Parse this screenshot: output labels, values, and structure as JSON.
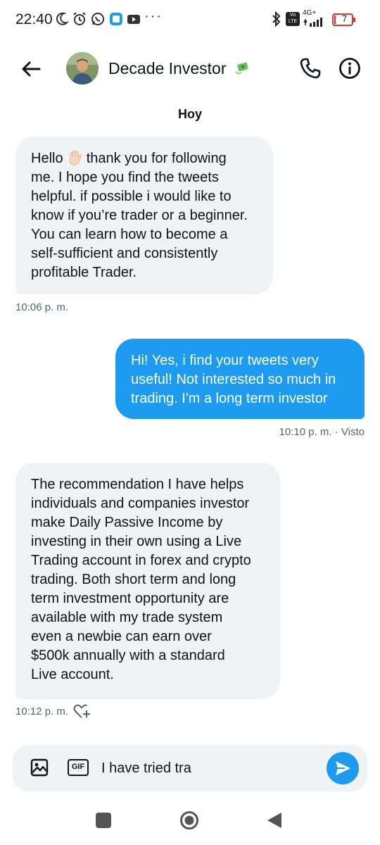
{
  "status_bar": {
    "time": "22:40",
    "network": "4G+",
    "volte": "Vo LTE",
    "battery": "7",
    "overflow": "···"
  },
  "header": {
    "contact_name": "Decade Investor",
    "icons": [
      "back-arrow-icon",
      "money-with-wings-emoji",
      "phone-icon",
      "info-icon"
    ]
  },
  "conversation": {
    "date_label": "Hoy",
    "messages": [
      {
        "direction": "incoming",
        "text_before_emoji": "Hello ",
        "emoji": "waving-hand-emoji",
        "text": " thank you for following\nme. I hope you find the tweets\nhelpful. if possible i would like to\nknow if you’re trader or a beginner.\nYou can learn how to become a\nself-sufficient and consistently\nprofitable Trader.",
        "time": "10:06 p. m."
      },
      {
        "direction": "outgoing",
        "text": "Hi! Yes, i find your tweets very\nuseful! Not interested so much in\ntrading. I'm a long term investor",
        "time": "10:10 p. m. · Visto"
      },
      {
        "direction": "incoming",
        "text": "The recommendation I have helps\nindividuals and companies investor\nmake Daily Passive Income by\ninvesting in their own using a Live\nTrading account in forex and crypto\ntrading. Both short term and long\nterm investment opportunity are\navailable with my trade system\neven a newbie can earn over\n$500k annually with a standard\nLive account.",
        "time": "10:12 p. m."
      }
    ]
  },
  "composer": {
    "value": "I have tried tra",
    "gif_label": "GIF"
  },
  "colors": {
    "accent": "#1d9bf0",
    "incoming_bubble": "#eff3f4",
    "meta_text": "#536471"
  }
}
